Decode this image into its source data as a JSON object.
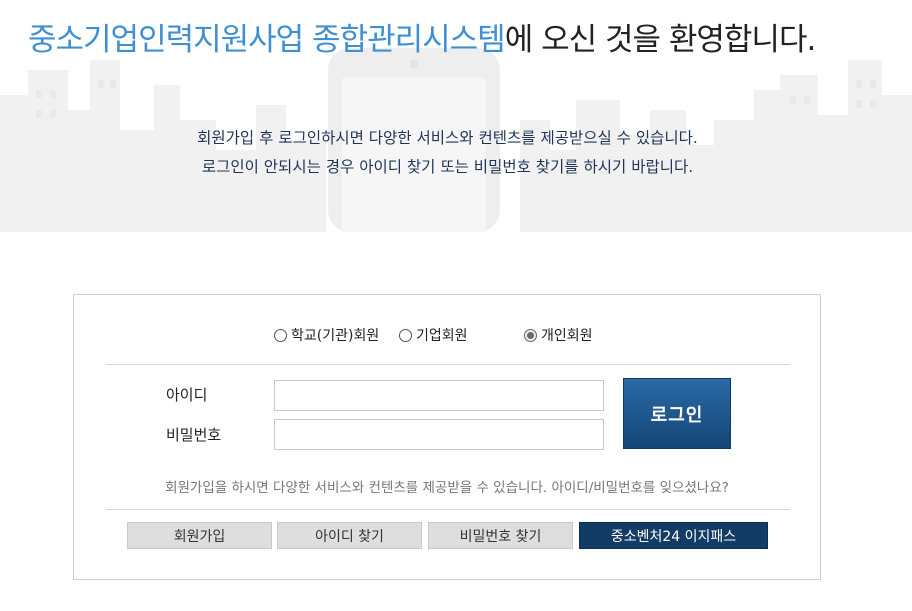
{
  "hero": {
    "title_accent": "중소기업인력지원사업 종합관리시스템",
    "title_rest": "에 오신 것을 환영합니다.",
    "intro_line1": "회원가입 후 로그인하시면 다양한 서비스와 컨텐츠를 제공받으실 수 있습니다.",
    "intro_line2": "로그인이 안되시는 경우 아이디 찾기 또는 비밀번호 찾기를 하시기 바랍니다."
  },
  "login": {
    "member_types": [
      {
        "label": "학교(기관)회원",
        "checked": false
      },
      {
        "label": "기업회원",
        "checked": false
      },
      {
        "label": "개인회원",
        "checked": true
      }
    ],
    "id_label": "아이디",
    "id_value": "",
    "password_label": "비밀번호",
    "password_value": "",
    "login_button": "로그인",
    "help_text": "회원가입을 하시면 다양한 서비스와 컨텐츠를 제공받을 수 있습니다. 아이디/비밀번호를 잊으셨나요?",
    "actions": [
      "회원가입",
      "아이디 찾기",
      "비밀번호 찾기",
      "중소벤처24 이지패스"
    ]
  },
  "colors": {
    "accent_blue": "#3f8fd2",
    "login_button": "#144574",
    "easypass_button": "#123b66",
    "secondary_button": "#dedede"
  }
}
